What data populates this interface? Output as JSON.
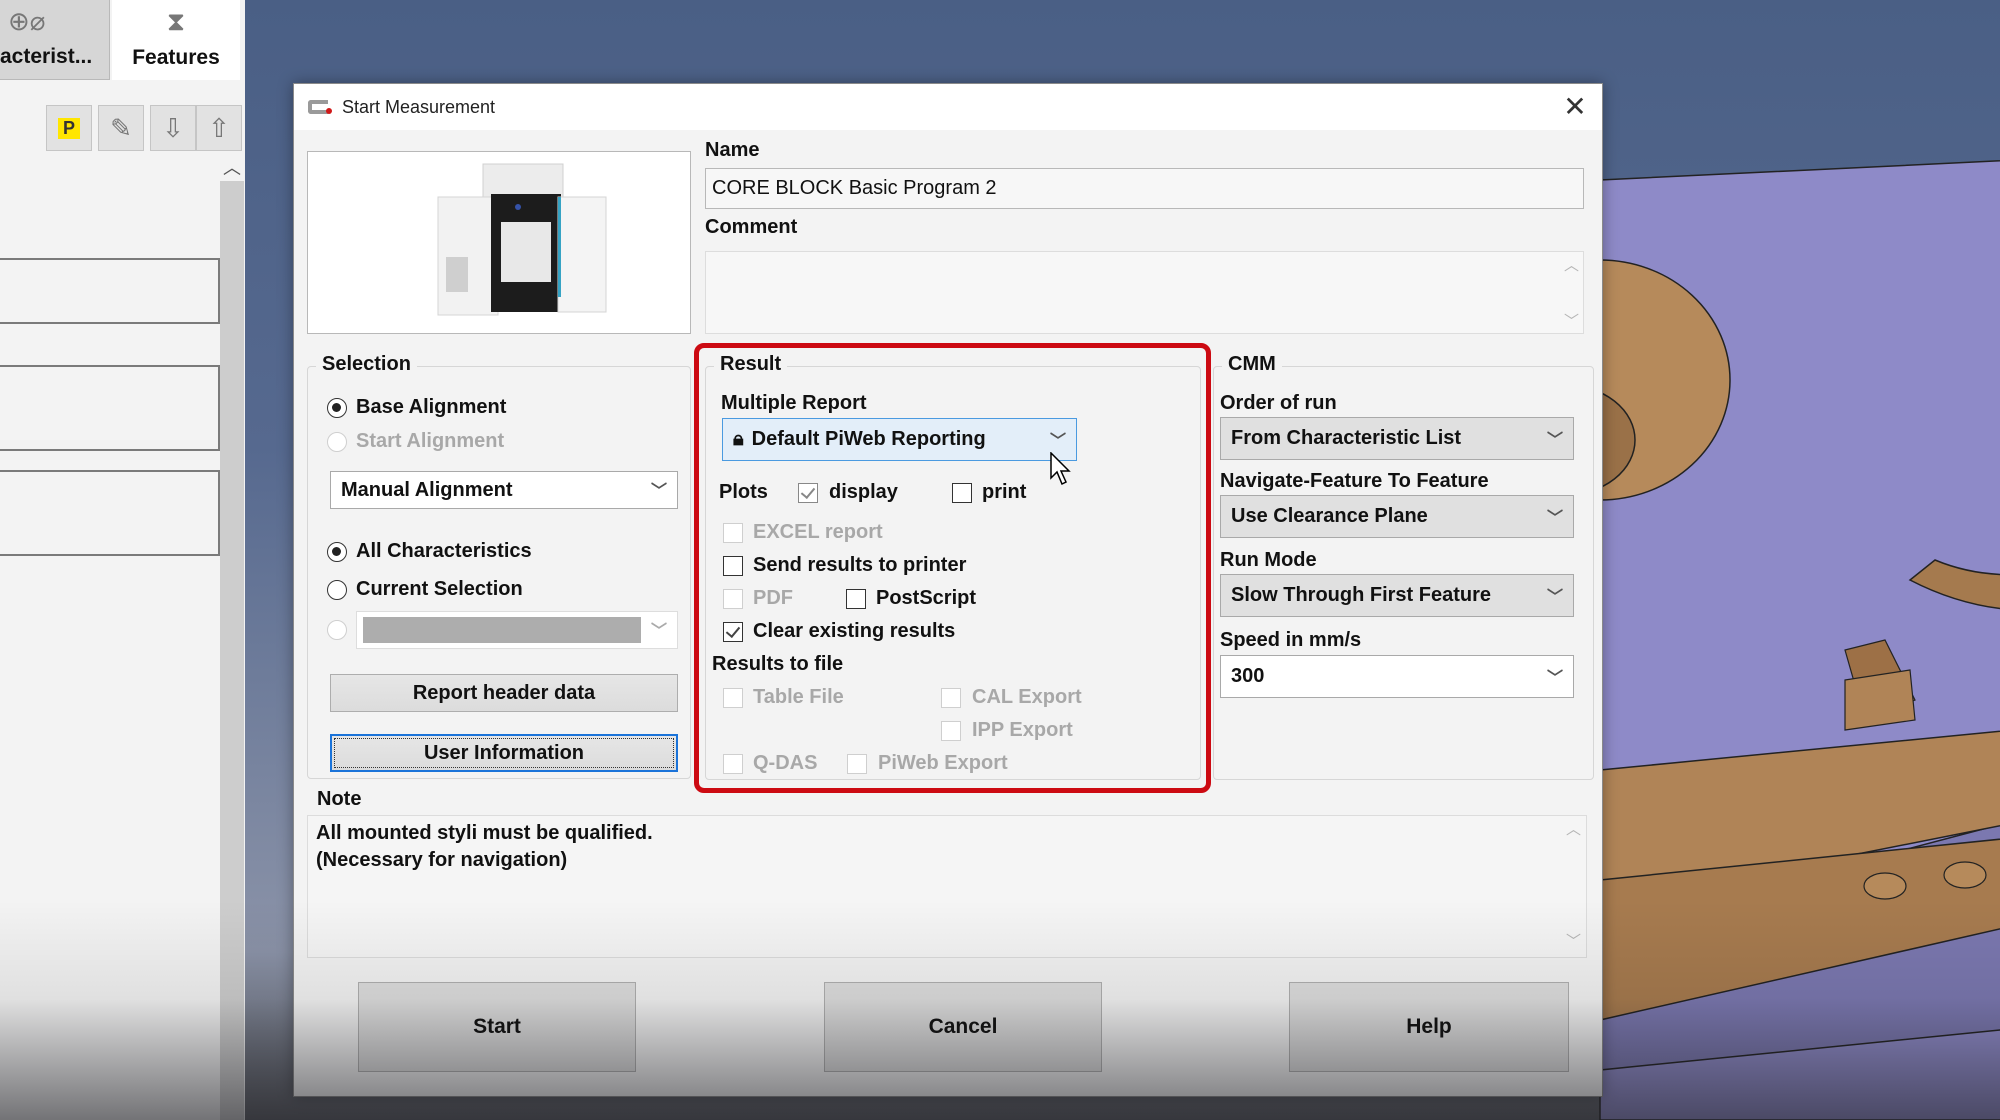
{
  "app": {
    "tabs": [
      {
        "label": "acterist...",
        "icon": "characteristics-icon"
      },
      {
        "label": "Features",
        "icon": "features-icon"
      }
    ],
    "toolbar": [
      {
        "name": "parameter-button",
        "glyph": "P"
      },
      {
        "name": "edit-button",
        "glyph": "✎"
      },
      {
        "name": "move-down-button",
        "glyph": "⇩"
      },
      {
        "name": "move-up-button",
        "glyph": "⇧"
      }
    ],
    "scroll_up_glyph": "︿"
  },
  "dialog": {
    "title": "Start Measurement",
    "close_glyph": "✕",
    "name": {
      "label": "Name",
      "value": "CORE BLOCK Basic Program 2"
    },
    "comment": {
      "label": "Comment",
      "value": ""
    },
    "selection": {
      "title": "Selection",
      "base_alignment": {
        "label": "Base Alignment",
        "checked": true
      },
      "start_alignment": {
        "label": "Start Alignment",
        "checked": false,
        "disabled": true
      },
      "alignment_combo": {
        "value": "Manual Alignment"
      },
      "all_characteristics": {
        "label": "All Characteristics",
        "checked": true
      },
      "current_selection": {
        "label": "Current Selection",
        "checked": false
      },
      "third_option": {
        "checked": false,
        "disabled": true,
        "value": ""
      },
      "report_header_button": "Report header data",
      "user_information_button": "User Information"
    },
    "result": {
      "title": "Result",
      "multiple_report_label": "Multiple Report",
      "multiple_report_value": "Default PiWeb Reporting",
      "plots_label": "Plots",
      "display": {
        "label": "display",
        "checked": true
      },
      "print": {
        "label": "print",
        "checked": false
      },
      "excel_report": {
        "label": "EXCEL report",
        "checked": false,
        "disabled": true
      },
      "send_to_printer": {
        "label": "Send results to printer",
        "checked": false
      },
      "pdf": {
        "label": "PDF",
        "checked": false,
        "disabled": true
      },
      "postscript": {
        "label": "PostScript",
        "checked": false
      },
      "clear_existing": {
        "label": "Clear existing results",
        "checked": true
      },
      "results_to_file_label": "Results to file",
      "table_file": {
        "label": "Table File",
        "checked": false,
        "disabled": true
      },
      "cal_export": {
        "label": "CAL Export",
        "checked": false,
        "disabled": true
      },
      "ipp_export": {
        "label": "IPP Export",
        "checked": false,
        "disabled": true
      },
      "qdas": {
        "label": "Q-DAS",
        "checked": false,
        "disabled": true
      },
      "piweb_export": {
        "label": "PiWeb Export",
        "checked": false,
        "disabled": true
      },
      "highlight_color": "#cc0a12"
    },
    "cmm": {
      "title": "CMM",
      "order_of_run": {
        "label": "Order of run",
        "value": "From Characteristic List"
      },
      "navigate": {
        "label": "Navigate-Feature To Feature",
        "value": "Use Clearance Plane"
      },
      "run_mode": {
        "label": "Run Mode",
        "value": "Slow Through First Feature"
      },
      "speed": {
        "label": "Speed in mm/s",
        "value": "300"
      }
    },
    "note": {
      "label": "Note",
      "lines": [
        "All mounted styli must be qualified.",
        "(Necessary for navigation)"
      ]
    },
    "buttons": {
      "start": "Start",
      "cancel": "Cancel",
      "help": "Help"
    }
  }
}
